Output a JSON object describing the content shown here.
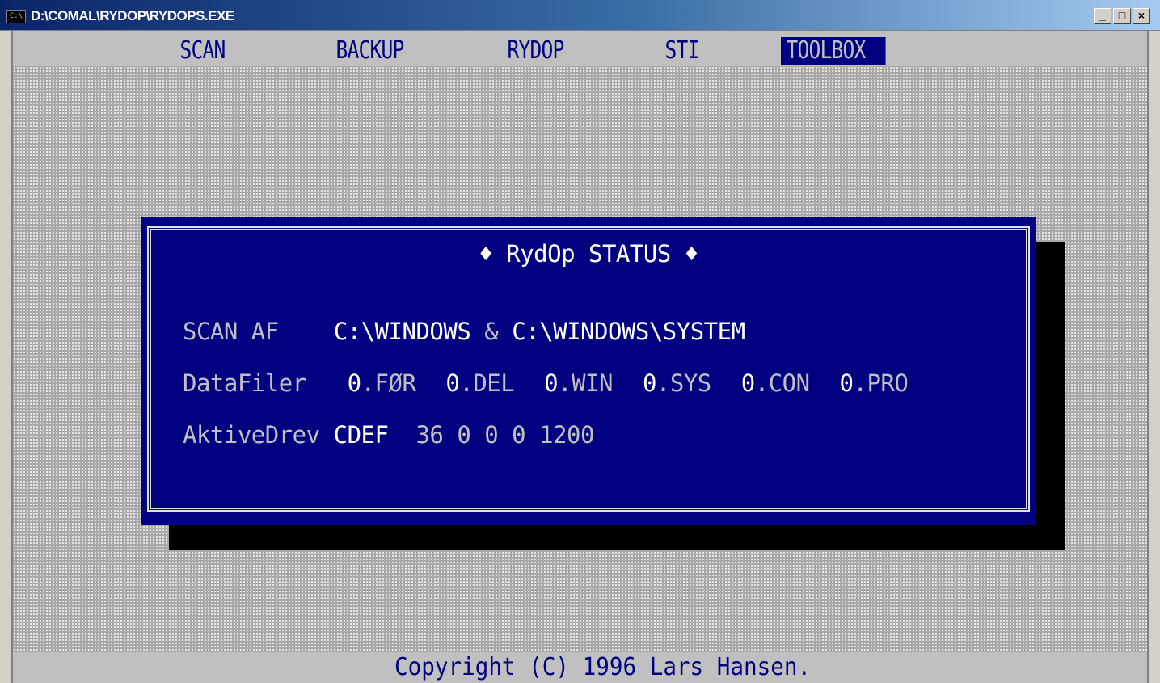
{
  "window": {
    "title": "D:\\COMAL\\RYDOP\\RYDOPS.EXE",
    "icon": "console-icon",
    "buttons": {
      "minimize": "_",
      "maximize": "□",
      "close": "×"
    }
  },
  "menu": {
    "items": [
      {
        "label": "SCAN"
      },
      {
        "label": "BACKUP"
      },
      {
        "label": "RYDOP"
      },
      {
        "label": "STI"
      },
      {
        "label": "TOOLBOX",
        "active": true
      }
    ]
  },
  "dialog": {
    "title": "♦ RydOp STATUS ♦",
    "scan_af": {
      "label": "SCAN AF",
      "value": "C:\\WINDOWS",
      "amp": "&",
      "value2": "C:\\WINDOWS\\SYSTEM"
    },
    "datafiler": {
      "label": "DataFiler",
      "items": [
        {
          "count": "0",
          "ext": ".FØR"
        },
        {
          "count": "0",
          "ext": ".DEL"
        },
        {
          "count": "0",
          "ext": ".WIN"
        },
        {
          "count": "0",
          "ext": ".SYS"
        },
        {
          "count": "0",
          "ext": ".CON"
        },
        {
          "count": "0",
          "ext": ".PRO"
        }
      ]
    },
    "aktivedrev": {
      "label": "AktiveDrev",
      "drives": "CDEF",
      "numbers": "36 0 0 0 1200"
    }
  },
  "footer": {
    "text": "Copyright (C) 1996 Lars Hansen."
  },
  "colors": {
    "dialog_bg": "#000080",
    "menu_bg": "#c0c0c0",
    "desktop_pattern": "#a8a8a8"
  }
}
